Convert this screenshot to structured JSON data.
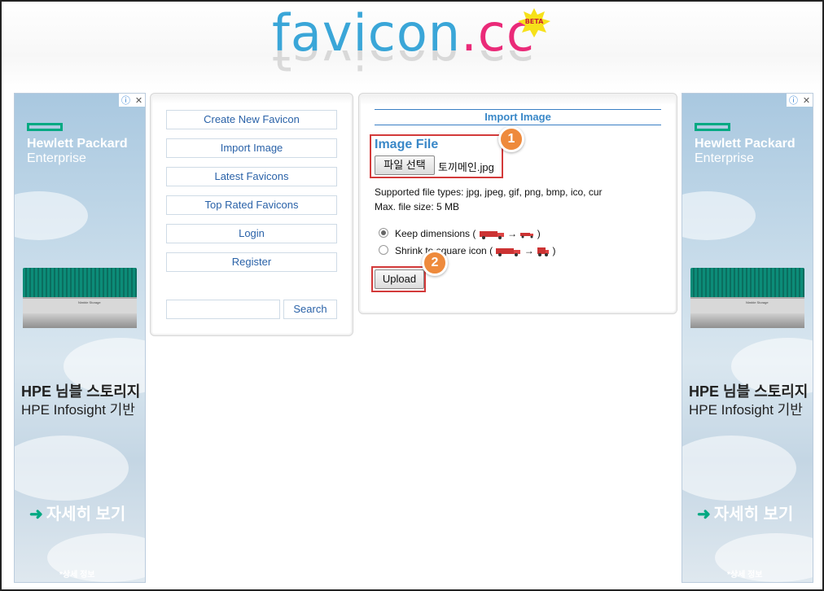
{
  "header": {
    "logo_part1": "favicon",
    "logo_dot": ".",
    "logo_part2": "cc",
    "badge": "BETA"
  },
  "ads": {
    "brand_line1": "Hewlett Packard",
    "brand_line2": "Enterprise",
    "headline1": "HPE 님블 스토리지",
    "headline2": "HPE Infosight 기반",
    "cta": "자세히 보기",
    "info": "*상세 정보",
    "server_label": "Nimble Storage"
  },
  "nav": {
    "items": [
      {
        "label": "Create New Favicon"
      },
      {
        "label": "Import Image"
      },
      {
        "label": "Latest Favicons"
      },
      {
        "label": "Top Rated Favicons"
      },
      {
        "label": "Login"
      },
      {
        "label": "Register"
      }
    ],
    "search_button": "Search",
    "search_value": ""
  },
  "import": {
    "title": "Import Image",
    "file_label": "Image File",
    "file_button": "파일 선택",
    "file_name": "토끼메인.jpg",
    "supported": "Supported file types: jpg, jpeg, gif, png, bmp, ico, cur",
    "max_size": "Max. file size: 5 MB",
    "option_keep": "Keep dimensions (",
    "option_shrink": "Shrink to square icon (",
    "close_paren": ")",
    "arrow": "→",
    "upload_button": "Upload",
    "selected_option": "Keep dimensions"
  },
  "annotations": {
    "step1": "1",
    "step2": "2"
  },
  "colors": {
    "accent_blue": "#3a88c8",
    "highlight_red": "#d33a3a",
    "step_orange": "#ee8a3c",
    "hpe_green": "#01a982"
  }
}
